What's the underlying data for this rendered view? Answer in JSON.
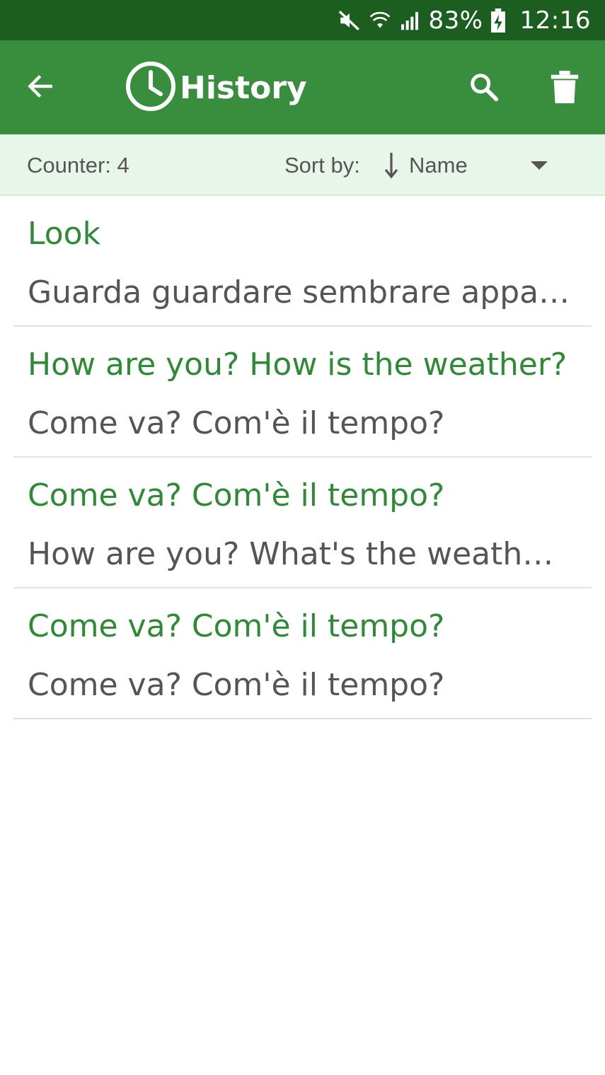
{
  "status_bar": {
    "icons": [
      "mute-icon",
      "wifi-icon",
      "signal-icon",
      "battery-charging-icon"
    ],
    "battery": "83%",
    "time": "12:16"
  },
  "app_bar": {
    "title": "History",
    "back_icon": "arrow-back-icon",
    "title_icon": "clock-icon",
    "search_icon": "search-icon",
    "delete_icon": "trash-icon"
  },
  "filter_bar": {
    "counter": "Counter: 4",
    "sort_label": "Sort by:",
    "sort_value": "Name",
    "sort_direction_icon": "arrow-down-icon"
  },
  "history": [
    {
      "source": "Look",
      "translation": "Guarda  guardare sembrare apparire aspetto"
    },
    {
      "source": "How are you? How is the weather?",
      "translation": "Come va? Com'è il tempo?"
    },
    {
      "source": "Come va? Com'è il tempo?",
      "translation": "How are you? What's the weather like?"
    },
    {
      "source": "Come va? Com'è il tempo?",
      "translation": "Come va? Com'è il tempo?"
    }
  ],
  "colors": {
    "status_bar": "#1b5e20",
    "app_bar": "#388e3c",
    "filter_bar": "#e8f5e9",
    "source_text": "#2e8b35",
    "translation_text": "#555555"
  }
}
